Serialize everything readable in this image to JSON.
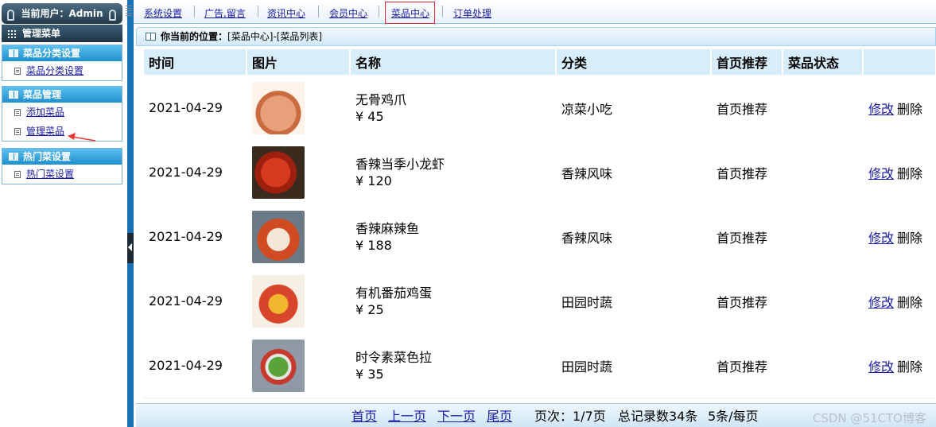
{
  "sidebar": {
    "user_label": "当前用户：Admin",
    "menu_title": "管理菜单",
    "groups": [
      {
        "title": "菜品分类设置",
        "items": [
          "菜品分类设置"
        ]
      },
      {
        "title": "菜品管理",
        "items": [
          "添加菜品",
          "管理菜品"
        ]
      },
      {
        "title": "热门菜设置",
        "items": [
          "热门菜设置"
        ]
      }
    ]
  },
  "topnav": {
    "items": [
      "系统设置",
      "广告,留言",
      "资讯中心",
      "会员中心",
      "菜品中心",
      "订单处理"
    ],
    "active": "菜品中心"
  },
  "breadcrumb": {
    "label": "你当前的位置：",
    "path": "[菜品中心]-[菜品列表]"
  },
  "table": {
    "headers": [
      "时间",
      "图片",
      "名称",
      "分类",
      "首页推荐",
      "菜品状态",
      ""
    ],
    "rows": [
      {
        "time": "2021-04-29",
        "name": "无骨鸡爪",
        "price": "¥ 45",
        "category": "凉菜小吃",
        "recommend": "首页推荐",
        "status": "",
        "edit": "修改",
        "delete": "删除",
        "image": "chicken-feet"
      },
      {
        "time": "2021-04-29",
        "name": "香辣当季小龙虾",
        "price": "¥ 120",
        "category": "香辣风味",
        "recommend": "首页推荐",
        "status": "",
        "edit": "修改",
        "delete": "删除",
        "image": "crayfish"
      },
      {
        "time": "2021-04-29",
        "name": "香辣麻辣鱼",
        "price": "¥ 188",
        "category": "香辣风味",
        "recommend": "首页推荐",
        "status": "",
        "edit": "修改",
        "delete": "删除",
        "image": "spicy-fish"
      },
      {
        "time": "2021-04-29",
        "name": "有机番茄鸡蛋",
        "price": "¥ 25",
        "category": "田园时蔬",
        "recommend": "首页推荐",
        "status": "",
        "edit": "修改",
        "delete": "删除",
        "image": "tomato-egg"
      },
      {
        "time": "2021-04-29",
        "name": "时令素菜色拉",
        "price": "¥ 35",
        "category": "田园时蔬",
        "recommend": "首页推荐",
        "status": "",
        "edit": "修改",
        "delete": "删除",
        "image": "veg-salad"
      }
    ]
  },
  "pager": {
    "first": "首页",
    "prev": "上一页",
    "next": "下一页",
    "last": "尾页",
    "page_info": "页次：1/7页",
    "total": "总记录数34条",
    "per_page": "5条/每页"
  },
  "watermark": "CSDN @51CTO博客",
  "colors": {
    "accent_blue": "#1a72b5",
    "header_bg": "#d8edfa",
    "active_border": "#e1272d"
  }
}
